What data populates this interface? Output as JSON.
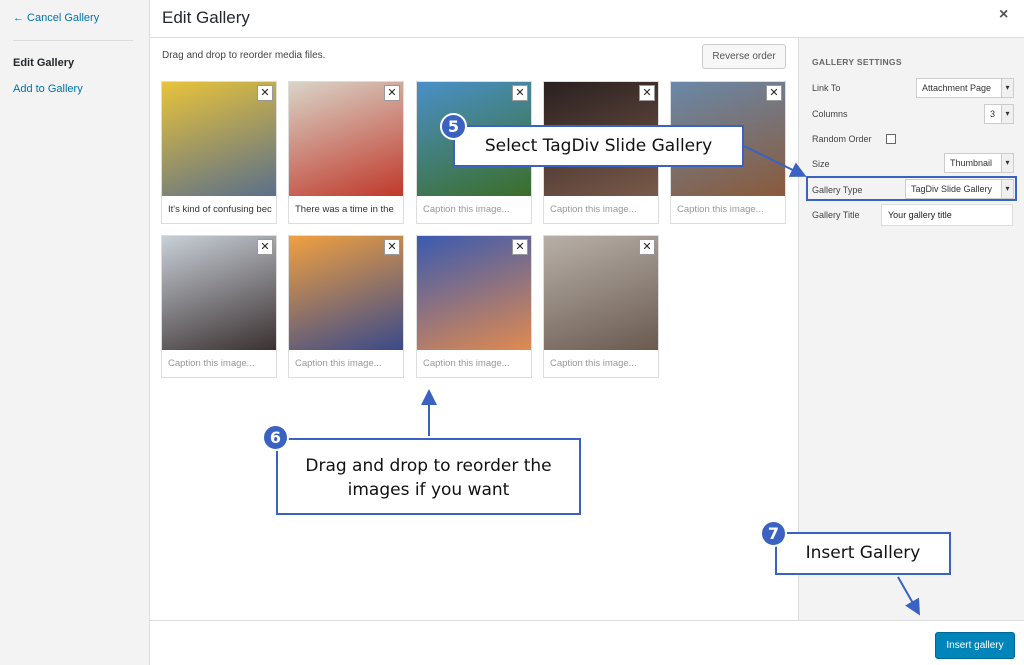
{
  "sidebar": {
    "cancel": "← Cancel Gallery",
    "items": [
      "Edit Gallery",
      "Add to Gallery"
    ]
  },
  "header": {
    "title": "Edit Gallery",
    "close": "×"
  },
  "main": {
    "instruction": "Drag and drop to reorder media files.",
    "reverse_label": "Reverse order",
    "tiles": [
      {
        "caption": "It's kind of confusing bec",
        "placeholder": false,
        "colors": [
          "#e8c33a",
          "#5a6f8a"
        ]
      },
      {
        "caption": "There was a time in the",
        "placeholder": false,
        "colors": [
          "#d9d4c8",
          "#c0392b"
        ]
      },
      {
        "caption": "Caption this image...",
        "placeholder": true,
        "colors": [
          "#4a90c8",
          "#3b6e2a"
        ]
      },
      {
        "caption": "Caption this image...",
        "placeholder": true,
        "colors": [
          "#2a2020",
          "#7a5a4a"
        ]
      },
      {
        "caption": "Caption this image...",
        "placeholder": true,
        "colors": [
          "#6a88a8",
          "#8a5a3a"
        ]
      },
      {
        "caption": "Caption this image...",
        "placeholder": true,
        "colors": [
          "#c9d0d8",
          "#3a3030"
        ]
      },
      {
        "caption": "Caption this image...",
        "placeholder": true,
        "colors": [
          "#f0a040",
          "#3a4a8a"
        ]
      },
      {
        "caption": "Caption this image...",
        "placeholder": true,
        "colors": [
          "#3a5ab0",
          "#e08a50"
        ]
      },
      {
        "caption": "Caption this image...",
        "placeholder": true,
        "colors": [
          "#b8b0a8",
          "#6a5a50"
        ]
      }
    ]
  },
  "settings": {
    "heading": "GALLERY SETTINGS",
    "link_to_label": "Link To",
    "link_to_value": "Attachment Page",
    "columns_label": "Columns",
    "columns_value": "3",
    "random_label": "Random Order",
    "size_label": "Size",
    "size_value": "Thumbnail",
    "type_label": "Gallery Type",
    "type_value": "TagDiv Slide Gallery",
    "title_label": "Gallery Title",
    "title_value": "Your gallery title"
  },
  "footer": {
    "insert_label": "Insert gallery"
  },
  "callouts": {
    "c5": {
      "num": "5",
      "text": "Select TagDiv Slide Gallery"
    },
    "c6": {
      "num": "6",
      "text": "Drag and drop to reorder the images if you want"
    },
    "c7": {
      "num": "7",
      "text": "Insert Gallery"
    }
  },
  "colors": {
    "accent": "#0085ba",
    "callout": "#3a62c2",
    "link": "#0073aa"
  }
}
